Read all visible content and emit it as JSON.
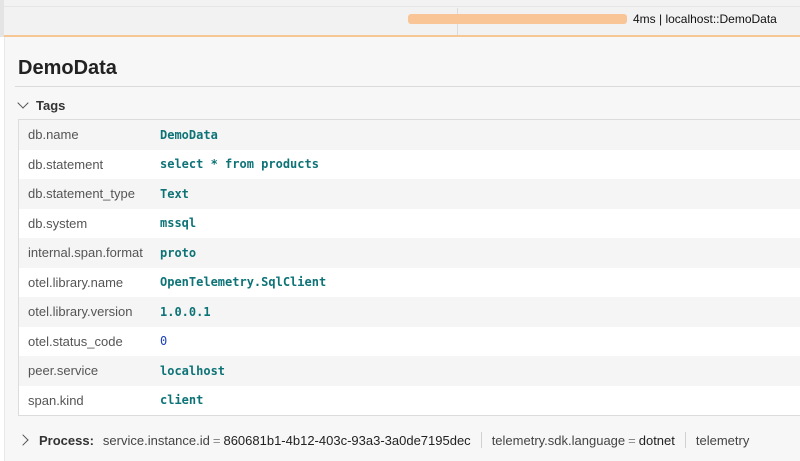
{
  "timeline": {
    "span_label": "4ms | localhost::DemoData",
    "bar_color": "#f9c597",
    "bar_start_fraction": 0.49,
    "bar_width_fraction": 0.28
  },
  "detail": {
    "title": "DemoData",
    "tags_section": {
      "label": "Tags",
      "expanded": true,
      "rows": [
        {
          "key": "db.name",
          "value": "DemoData",
          "type": "string"
        },
        {
          "key": "db.statement",
          "value": "select * from products",
          "type": "string"
        },
        {
          "key": "db.statement_type",
          "value": "Text",
          "type": "string"
        },
        {
          "key": "db.system",
          "value": "mssql",
          "type": "string"
        },
        {
          "key": "internal.span.format",
          "value": "proto",
          "type": "string"
        },
        {
          "key": "otel.library.name",
          "value": "OpenTelemetry.SqlClient",
          "type": "string"
        },
        {
          "key": "otel.library.version",
          "value": "1.0.0.1",
          "type": "string"
        },
        {
          "key": "otel.status_code",
          "value": "0",
          "type": "number"
        },
        {
          "key": "peer.service",
          "value": "localhost",
          "type": "string"
        },
        {
          "key": "span.kind",
          "value": "client",
          "type": "string"
        }
      ]
    },
    "process_section": {
      "label": "Process:",
      "expanded": false,
      "items": [
        {
          "key": "service.instance.id",
          "value": "860681b1-4b12-403c-93a3-3a0de7195dec"
        },
        {
          "key": "telemetry.sdk.language",
          "value": "dotnet"
        },
        {
          "key": "telemetry",
          "value": ""
        }
      ]
    }
  },
  "colors": {
    "string_value": "#0d7377",
    "number_value": "#1a3fbf",
    "accent_border": "#f6c694"
  }
}
